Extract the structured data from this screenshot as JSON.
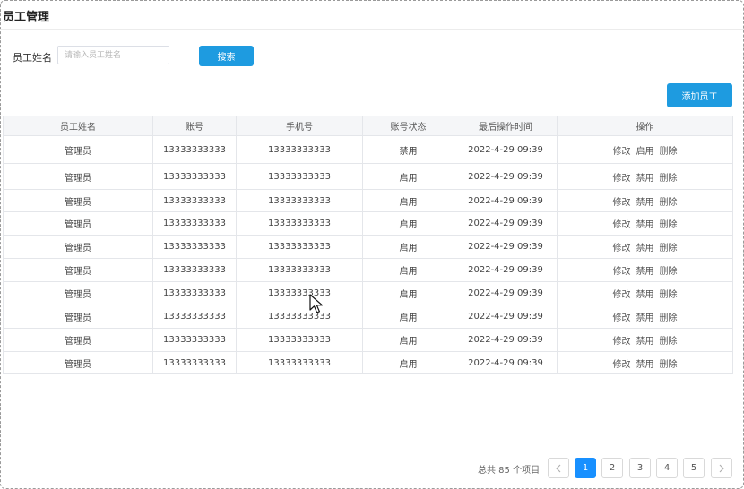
{
  "page": {
    "title": "员工管理"
  },
  "search": {
    "label": "员工姓名",
    "placeholder": "请输入员工姓名",
    "value": "",
    "button": "搜索"
  },
  "toolbar": {
    "add_label": "添加员工"
  },
  "table": {
    "columns": [
      "员工姓名",
      "账号",
      "手机号",
      "账号状态",
      "最后操作时间",
      "操作"
    ],
    "rows": [
      {
        "name": "管理员",
        "account": "13333333333",
        "phone": "13333333333",
        "status": "禁用",
        "time": "2022-4-29 09:39",
        "actions": [
          "修改",
          "启用",
          "删除"
        ]
      },
      {
        "name": "管理员",
        "account": "13333333333",
        "phone": "13333333333",
        "status": "启用",
        "time": "2022-4-29 09:39",
        "actions": [
          "修改",
          "禁用",
          "删除"
        ]
      },
      {
        "name": "管理员",
        "account": "13333333333",
        "phone": "13333333333",
        "status": "启用",
        "time": "2022-4-29 09:39",
        "actions": [
          "修改",
          "禁用",
          "删除"
        ]
      },
      {
        "name": "管理员",
        "account": "13333333333",
        "phone": "13333333333",
        "status": "启用",
        "time": "2022-4-29 09:39",
        "actions": [
          "修改",
          "禁用",
          "删除"
        ]
      },
      {
        "name": "管理员",
        "account": "13333333333",
        "phone": "13333333333",
        "status": "启用",
        "time": "2022-4-29 09:39",
        "actions": [
          "修改",
          "禁用",
          "删除"
        ]
      },
      {
        "name": "管理员",
        "account": "13333333333",
        "phone": "13333333333",
        "status": "启用",
        "time": "2022-4-29 09:39",
        "actions": [
          "修改",
          "禁用",
          "删除"
        ]
      },
      {
        "name": "管理员",
        "account": "13333333333",
        "phone": "13333333333",
        "status": "启用",
        "time": "2022-4-29 09:39",
        "actions": [
          "修改",
          "禁用",
          "删除"
        ]
      },
      {
        "name": "管理员",
        "account": "13333333333",
        "phone": "13333333333",
        "status": "启用",
        "time": "2022-4-29 09:39",
        "actions": [
          "修改",
          "禁用",
          "删除"
        ]
      },
      {
        "name": "管理员",
        "account": "13333333333",
        "phone": "13333333333",
        "status": "启用",
        "time": "2022-4-29 09:39",
        "actions": [
          "修改",
          "禁用",
          "删除"
        ]
      },
      {
        "name": "管理员",
        "account": "13333333333",
        "phone": "13333333333",
        "status": "启用",
        "time": "2022-4-29 09:39",
        "actions": [
          "修改",
          "禁用",
          "删除"
        ]
      }
    ]
  },
  "pagination": {
    "total_text": "总共 85 个项目",
    "pages": [
      "1",
      "2",
      "3",
      "4",
      "5"
    ],
    "current": "1",
    "prev_icon": "chevron-left-icon",
    "next_icon": "chevron-right-icon"
  },
  "colors": {
    "primary": "#1e9be0",
    "active_page": "#1890ff",
    "header_bg": "#f5f6f8",
    "border": "#e4e6ea"
  }
}
